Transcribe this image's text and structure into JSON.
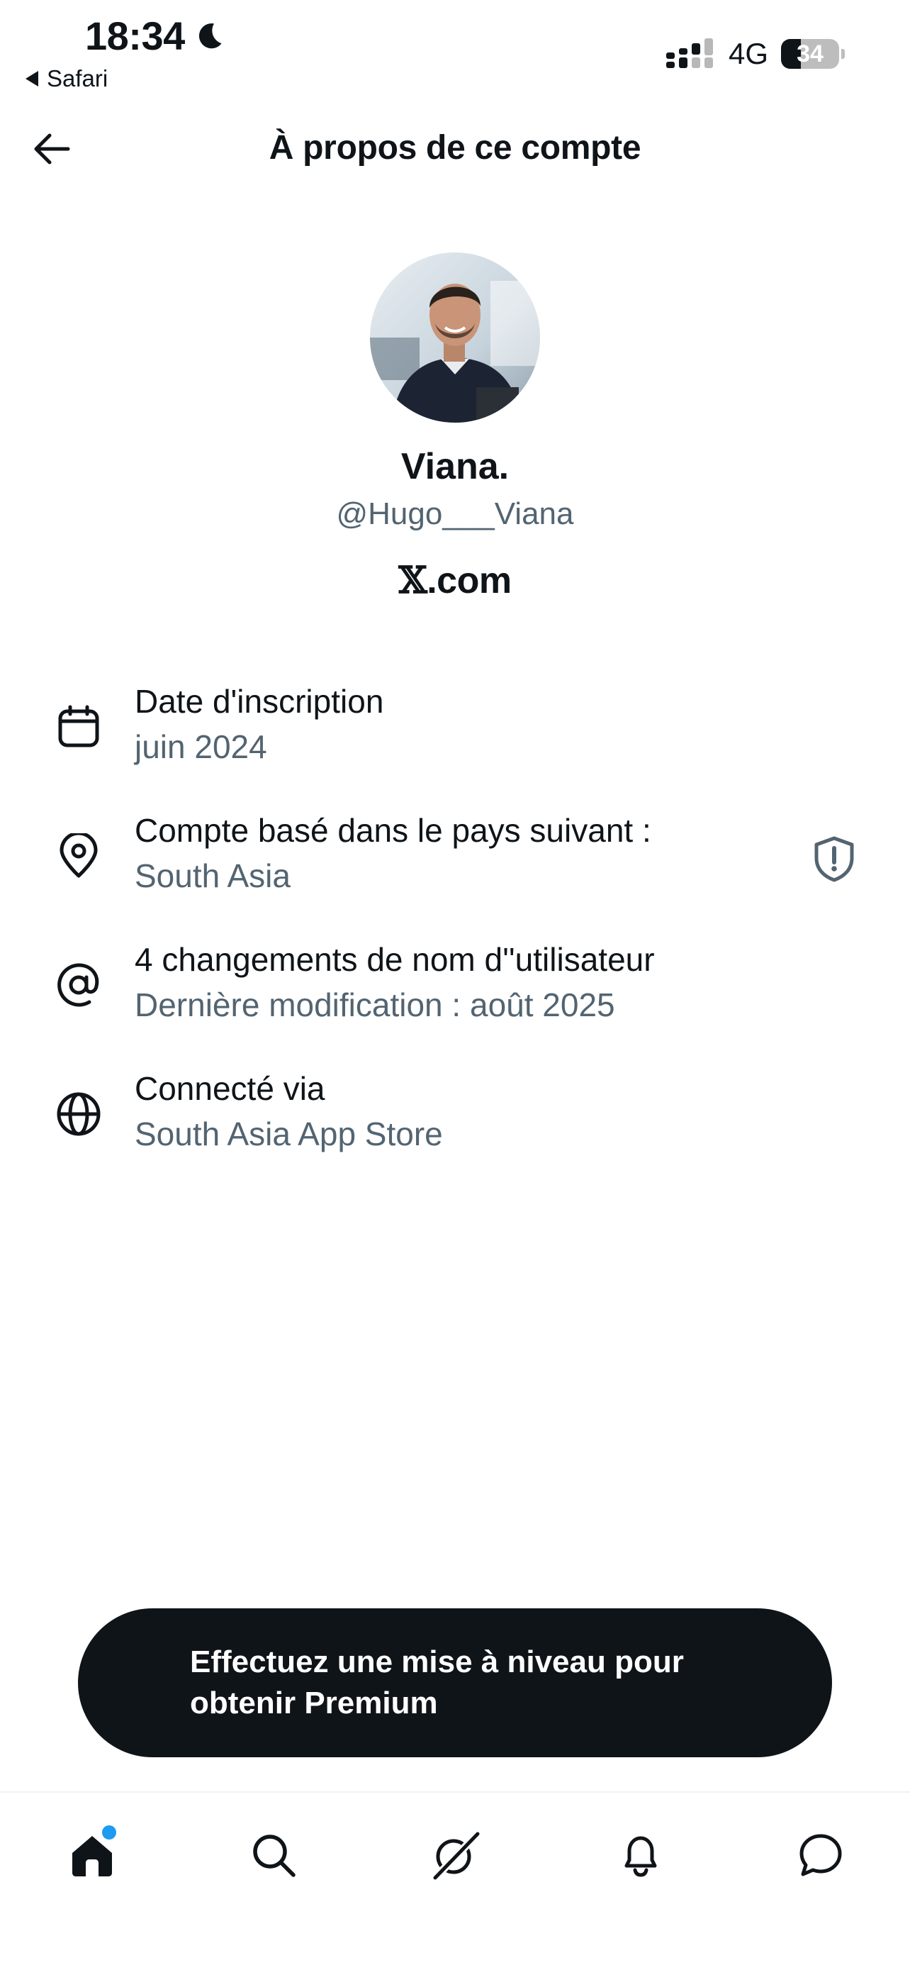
{
  "status_bar": {
    "time": "18:34",
    "back_app": "Safari",
    "network": "4G",
    "battery": "34",
    "battery_level": 0.34
  },
  "header": {
    "title": "À propos de ce compte"
  },
  "profile": {
    "name": "Viana.",
    "handle": "@Hugo___Viana",
    "domain_suffix": ".com"
  },
  "info": [
    {
      "icon": "calendar-icon",
      "title": "Date d'inscription",
      "value": "juin 2024"
    },
    {
      "icon": "location-pin-icon",
      "title": "Compte basé dans le pays suivant :",
      "value": "South Asia",
      "extra_icon": "shield-alert-icon"
    },
    {
      "icon": "at-sign-icon",
      "title": "4 changements de nom d''utilisateur",
      "value": "Dernière modification : août 2025"
    },
    {
      "icon": "globe-icon",
      "title": "Connecté via",
      "value": "South Asia App Store"
    }
  ],
  "premium": {
    "label": "Effectuez une mise à niveau pour obtenir Premium"
  },
  "tabbar": {
    "items": [
      "home-icon",
      "search-icon",
      "grok-icon",
      "notifications-bell-icon",
      "messages-icon"
    ]
  },
  "colors": {
    "text_primary": "#0f1419",
    "text_secondary": "#536471",
    "accent": "#1d9bf0"
  }
}
